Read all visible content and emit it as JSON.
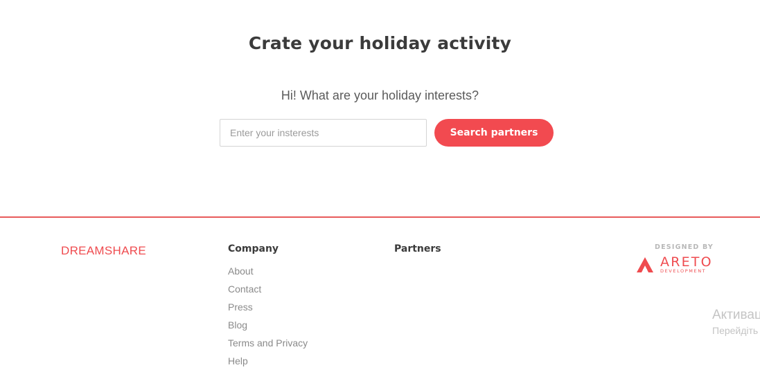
{
  "hero": {
    "title": "Crate your holiday activity",
    "question": "Hi! What are your holiday interests?",
    "search_placeholder": "Enter your insterests",
    "search_value": "",
    "search_button_label": "Search partners"
  },
  "footer": {
    "brand": "DREAMSHARE",
    "company_heading": "Company",
    "company_links": [
      "About",
      "Contact",
      "Press",
      "Blog",
      "Terms and Privacy",
      "Help"
    ],
    "partners_heading": "Partners",
    "designed_by": "DESIGNED BY",
    "designer_name": "ARETO",
    "designer_sub": "DEVELOPMENT"
  },
  "os_watermark": {
    "title": "Активац",
    "subtitle": "Перейдіть"
  },
  "colors": {
    "accent": "#f24a50",
    "divider": "#e85a5a",
    "heading": "#3b3b3b",
    "link": "#8a8a8a"
  },
  "icons": {
    "designer_logo": "areto-logo-icon"
  }
}
